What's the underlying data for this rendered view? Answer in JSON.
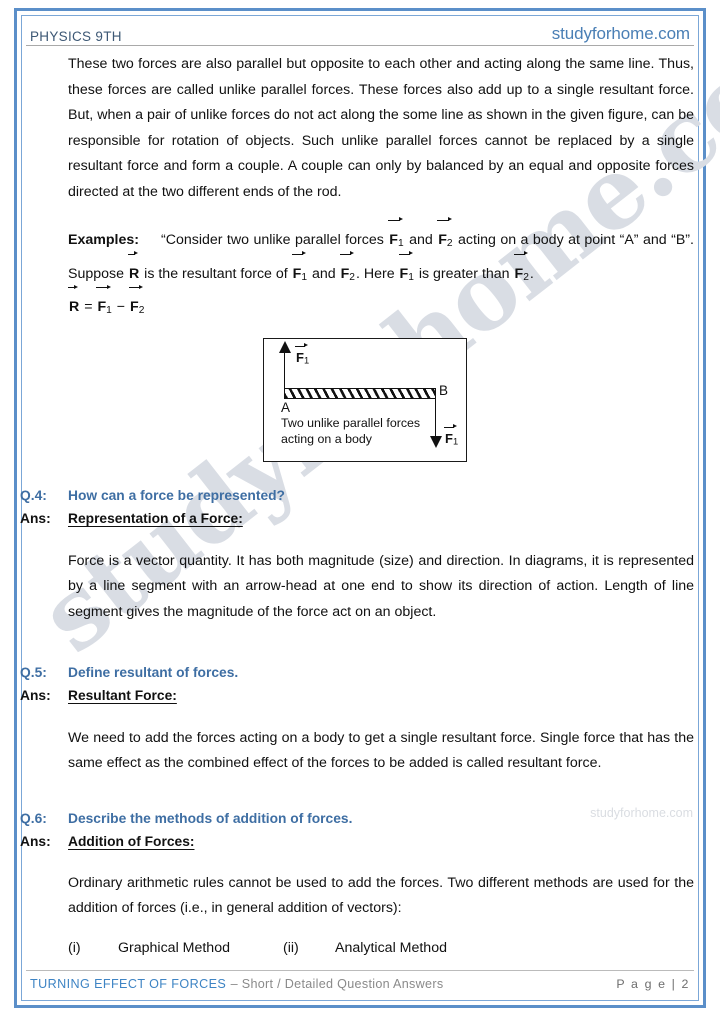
{
  "header": {
    "left_title": "PHYSICS 9TH",
    "right_site": "studyforhome.com"
  },
  "watermarks": {
    "large": "studyforhome.com",
    "small": "studyforhome.com"
  },
  "body": {
    "intro_paragraph": "These two forces are also parallel but opposite to each other and acting along the same line. Thus, these forces are called unlike parallel forces. These forces also add up to a single resultant force. But, when a pair of unlike forces do not act along the some line as shown in the given figure, can be responsible for rotation of objects. Such unlike parallel forces cannot be replaced by a single resultant force and form a couple. A couple can only by balanced by an equal and opposite forces directed at the two different ends of the rod.",
    "examples": {
      "label": "Examples:",
      "text_1": "“Consider two unlike parallel forces",
      "text_2": "and",
      "text_3": "acting on a body at point “A” and “B”. Suppose",
      "text_4": "is the resultant force of",
      "text_5": "and",
      "text_6": ". Here",
      "text_7": "is greater than",
      "text_8": ".",
      "equation_lhs": "R",
      "equation_eq": "=",
      "equation_minus": "−",
      "vec_F": "F",
      "vec_R": "R",
      "sub_1": "1",
      "sub_2": "2"
    }
  },
  "figure": {
    "label_force_top": "F",
    "label_force_top_sub": "1",
    "label_force_bottom": "F",
    "label_force_bottom_sub": "1",
    "point_a": "A",
    "point_b": "B",
    "caption_line1": "Two unlike parallel forces",
    "caption_line2": "acting on a body"
  },
  "questions": [
    {
      "tag": "Q.4:",
      "question": "How can a force be represented?",
      "ans_tag": "Ans:",
      "ans_heading": "Representation of a Force:",
      "ans_body": "Force is a vector quantity. It has both magnitude (size) and direction. In diagrams, it is represented by a line segment with an arrow-head at one end to show its direction of action. Length of line segment gives the magnitude of the force act on an object."
    },
    {
      "tag": "Q.5:",
      "question": "Define resultant of forces.",
      "ans_tag": "Ans:",
      "ans_heading": "Resultant Force:",
      "ans_body": "We need to add the forces acting on a body to get a single resultant force. Single force that has the same effect as the combined effect of the forces to be added is called resultant force."
    },
    {
      "tag": "Q.6:",
      "question": "Describe the methods of addition of forces.",
      "ans_tag": "Ans:",
      "ans_heading": "Addition of Forces:",
      "ans_body": "Ordinary arithmetic rules cannot be used to add the forces. Two different methods are used for the addition of forces (i.e., in general addition of vectors):",
      "methods": [
        {
          "num": "(i)",
          "name": "Graphical Method"
        },
        {
          "num": "(ii)",
          "name": "Analytical Method"
        }
      ]
    }
  ],
  "footer": {
    "title": "TURNING EFFECT OF FORCES",
    "subtitle": "– Short / Detailed Question Answers",
    "page": "P a g e | 2"
  },
  "colors": {
    "border_blue": "#5b8fc9",
    "question_blue": "#3e6ea3",
    "site_blue": "#4a7fb5",
    "footer_blue": "#3e84c4",
    "watermark_gray": "#d9dde4"
  }
}
